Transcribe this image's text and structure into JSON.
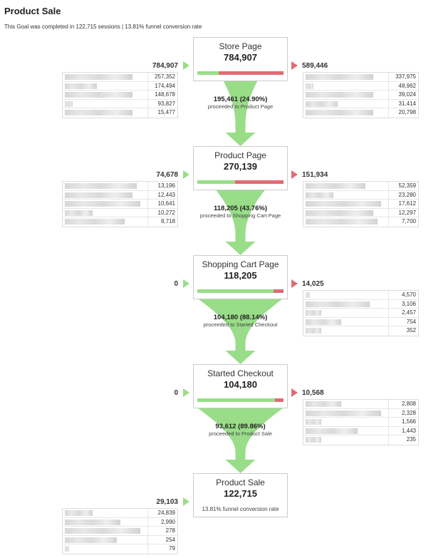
{
  "header": {
    "title": "Product Sale",
    "subtitle": "This Goal was completed in 122,715 sessions | 13.81% funnel conversion rate"
  },
  "colors": {
    "proceed": "#99dd88",
    "exit": "#e06b75",
    "border": "#cccccc"
  },
  "steps": [
    {
      "name": "Store Page",
      "value": "784,907",
      "proceed_fraction": 0.249,
      "entrances": "784,907",
      "exits": "589,446",
      "entrance_sources": [
        "257,352",
        "174,494",
        "148,678",
        "93,827",
        "15,477"
      ],
      "exit_destinations": [
        "337,975",
        "48,962",
        "39,024",
        "31,414",
        "20,798"
      ],
      "flow_main": "195,461 (24.90%)",
      "flow_sub": "proceeded to Product Page"
    },
    {
      "name": "Product Page",
      "value": "270,139",
      "proceed_fraction": 0.4376,
      "entrances": "74,678",
      "exits": "151,934",
      "entrance_sources": [
        "13,196",
        "12,443",
        "10,641",
        "10,272",
        "8,718"
      ],
      "exit_destinations": [
        "52,359",
        "23,280",
        "17,612",
        "12,297",
        "7,700"
      ],
      "flow_main": "118,205 (43.76%)",
      "flow_sub": "proceeded to Shopping Cart Page"
    },
    {
      "name": "Shopping Cart Page",
      "value": "118,205",
      "proceed_fraction": 0.8814,
      "entrances": "0",
      "exits": "14,025",
      "entrance_sources": [],
      "exit_destinations": [
        "4,570",
        "3,106",
        "2,457",
        "754",
        "352"
      ],
      "flow_main": "104,180 (88.14%)",
      "flow_sub": "proceeded to Started Checkout"
    },
    {
      "name": "Started Checkout",
      "value": "104,180",
      "proceed_fraction": 0.8986,
      "entrances": "0",
      "exits": "10,568",
      "entrance_sources": [],
      "exit_destinations": [
        "2,808",
        "2,328",
        "1,566",
        "1,443",
        "235"
      ],
      "flow_main": "93,612 (89.86%)",
      "flow_sub": "proceeded to Product Sale"
    },
    {
      "name": "Product Sale",
      "value": "122,715",
      "entrances": "29,103",
      "entrance_sources": [
        "24,839",
        "2,990",
        "278",
        "254",
        "79"
      ],
      "conversion_label": "13.81% funnel conversion rate"
    }
  ]
}
